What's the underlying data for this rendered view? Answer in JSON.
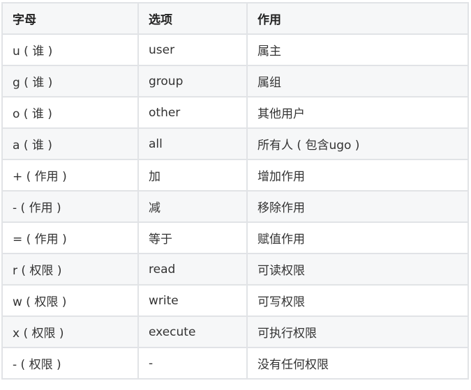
{
  "table": {
    "headers": [
      "字母",
      "选项",
      "作用"
    ],
    "rows": [
      [
        "u ( 谁 )",
        "user",
        "属主"
      ],
      [
        "g ( 谁 )",
        "group",
        "属组"
      ],
      [
        "o ( 谁 )",
        "other",
        "其他用户"
      ],
      [
        "a ( 谁 )",
        "all",
        "所有人 ( 包含ugo )"
      ],
      [
        "+ ( 作用 )",
        "加",
        "增加作用"
      ],
      [
        "- ( 作用 )",
        "减",
        "移除作用"
      ],
      [
        "= ( 作用 )",
        "等于",
        "赋值作用"
      ],
      [
        "r ( 权限 )",
        "read",
        "可读权限"
      ],
      [
        "w ( 权限 )",
        "write",
        "可写权限"
      ],
      [
        "x ( 权限 )",
        "execute",
        "可执行权限"
      ],
      [
        "- ( 权限 )",
        "-",
        "没有任何权限"
      ]
    ]
  }
}
